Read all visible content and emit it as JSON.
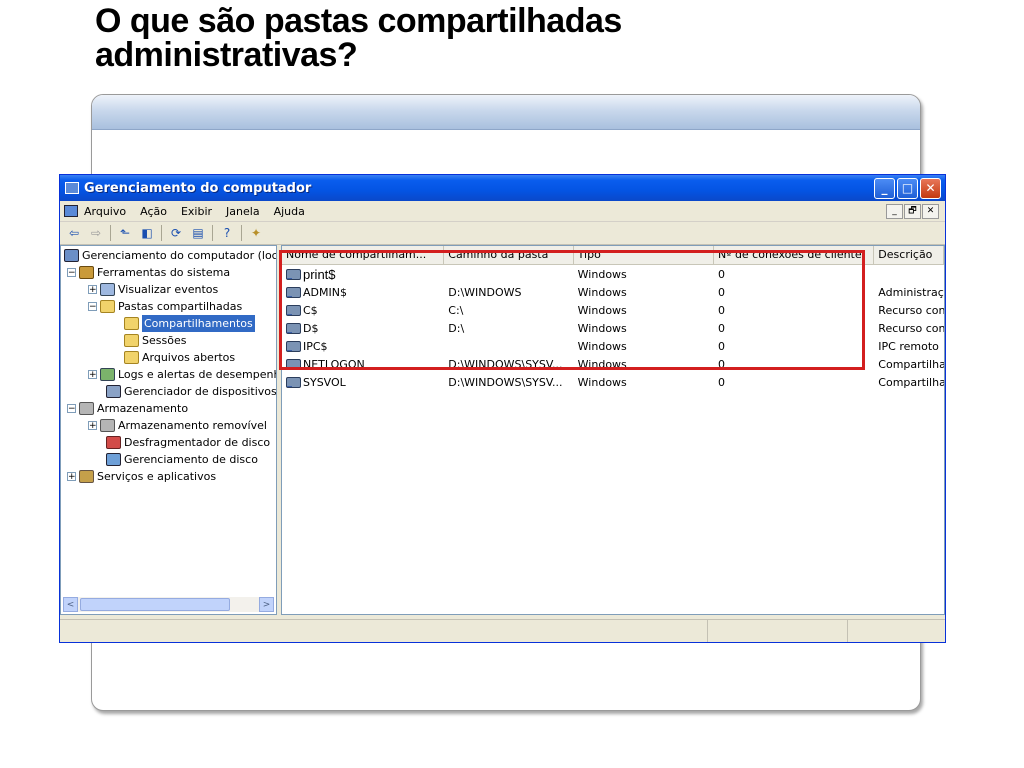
{
  "slide": {
    "title_line1": "O que são pastas compartilhadas",
    "title_line2": "administrativas?"
  },
  "window": {
    "title": "Gerenciamento do computador",
    "controls": {
      "minimize": "_",
      "maximize": "□",
      "close": "✕"
    }
  },
  "menu": {
    "items": [
      "Arquivo",
      "Ação",
      "Exibir",
      "Janela",
      "Ajuda"
    ],
    "right_controls": [
      "_",
      "🗗",
      "✕"
    ]
  },
  "toolbar": {
    "buttons": [
      "back-icon",
      "forward-icon",
      "up-folder-icon",
      "show-hide-tree-icon",
      "refresh-icon",
      "export-list-icon",
      "help-icon",
      "new-share-icon"
    ]
  },
  "tree": {
    "items": [
      {
        "label": "Gerenciamento do computador (local",
        "expander": "",
        "icon": "computer-icon",
        "indent": 0
      },
      {
        "label": "Ferramentas do sistema",
        "expander": "−",
        "icon": "tools-icon",
        "indent": 1
      },
      {
        "label": "Visualizar eventos",
        "expander": "+",
        "icon": "event-viewer-icon",
        "indent": 2
      },
      {
        "label": "Pastas compartilhadas",
        "expander": "−",
        "icon": "shared-folder-icon",
        "indent": 2
      },
      {
        "label": "Compartilhamentos",
        "expander": "",
        "icon": "shares-folder-icon",
        "indent": 3,
        "selected": true
      },
      {
        "label": "Sessões",
        "expander": "",
        "icon": "sessions-folder-icon",
        "indent": 3
      },
      {
        "label": "Arquivos abertos",
        "expander": "",
        "icon": "open-files-folder-icon",
        "indent": 3
      },
      {
        "label": "Logs e alertas de desempenh",
        "expander": "+",
        "icon": "perf-logs-icon",
        "indent": 2
      },
      {
        "label": "Gerenciador de dispositivos",
        "expander": "",
        "icon": "device-manager-icon",
        "indent": 2
      },
      {
        "label": "Armazenamento",
        "expander": "−",
        "icon": "storage-icon",
        "indent": 1
      },
      {
        "label": "Armazenamento removível",
        "expander": "+",
        "icon": "removable-storage-icon",
        "indent": 2
      },
      {
        "label": "Desfragmentador de disco",
        "expander": "",
        "icon": "defrag-icon",
        "indent": 2
      },
      {
        "label": "Gerenciamento de disco",
        "expander": "",
        "icon": "disk-management-icon",
        "indent": 2
      },
      {
        "label": "Serviços e aplicativos",
        "expander": "+",
        "icon": "services-icon",
        "indent": 1
      }
    ],
    "scroll_left": "<",
    "scroll_right": ">"
  },
  "list": {
    "columns": [
      "Nome de compartilham...",
      "Caminho da pasta",
      "Tipo",
      "Nº de conexões de cliente",
      "Descrição"
    ],
    "rows": [
      {
        "name": "print$",
        "path": "",
        "type": "Windows",
        "connections": "0",
        "description": ""
      },
      {
        "name": "ADMIN$",
        "path": "D:\\WINDOWS",
        "type": "Windows",
        "connections": "0",
        "description": "Administraçã"
      },
      {
        "name": "C$",
        "path": "C:\\",
        "type": "Windows",
        "connections": "0",
        "description": "Recurso con"
      },
      {
        "name": "D$",
        "path": "D:\\",
        "type": "Windows",
        "connections": "0",
        "description": "Recurso con"
      },
      {
        "name": "IPC$",
        "path": "",
        "type": "Windows",
        "connections": "0",
        "description": "IPC remoto"
      },
      {
        "name": "NETLOGON",
        "path": "D:\\WINDOWS\\SYSV...",
        "type": "Windows",
        "connections": "0",
        "description": "Compartilha"
      },
      {
        "name": "SYSVOL",
        "path": "D:\\WINDOWS\\SYSV...",
        "type": "Windows",
        "connections": "0",
        "description": "Compartilha"
      }
    ]
  },
  "colors": {
    "highlight_box": "#d31f1f",
    "titlebar": "#0a5ded",
    "selection": "#316ac5"
  }
}
